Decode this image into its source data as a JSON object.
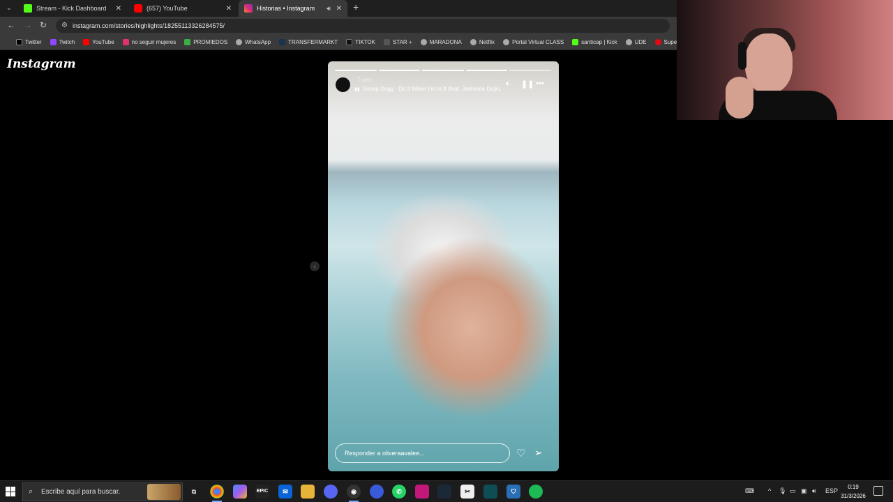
{
  "browser": {
    "tabs": [
      {
        "title": "Stream - Kick Dashboard",
        "favicon_color": "#53fc18"
      },
      {
        "title": "(657) YouTube",
        "favicon_color": "#ff0000"
      },
      {
        "title": "Historias • Instagram",
        "favicon_color": "#e1306c"
      }
    ],
    "url": "instagram.com/stories/highlights/18255113326284575/",
    "bookmarks": [
      {
        "label": "Twitter",
        "color": "#000000"
      },
      {
        "label": "Twitch",
        "color": "#9146ff"
      },
      {
        "label": "YouTube",
        "color": "#ff0000"
      },
      {
        "label": "no seguir mujeres",
        "color": "#e1306c"
      },
      {
        "label": "PROMIEDOS",
        "color": "#3cb043"
      },
      {
        "label": "WhatsApp",
        "color": "#aaaaaa"
      },
      {
        "label": "TRANSFERMARKT",
        "color": "#1a3151"
      },
      {
        "label": "TIKTOK",
        "color": "#111111"
      },
      {
        "label": "STAR +",
        "color": "#555555"
      },
      {
        "label": "MARADONA",
        "color": "#aaaaaa"
      },
      {
        "label": "Netflix",
        "color": "#aaaaaa"
      },
      {
        "label": "Portal Virtual CLASS",
        "color": "#aaaaaa"
      },
      {
        "label": "santicap | Kick",
        "color": "#53fc18"
      },
      {
        "label": "UDE",
        "color": "#aaaaaa"
      },
      {
        "label": "Supe",
        "color": "#e50914"
      }
    ]
  },
  "instagram": {
    "logo": "Instagram",
    "story": {
      "time_ago": "7 sem",
      "song": "Snoop Dogg · Do It When I'm In It (feat. Jermaine Dupri,",
      "progress_total": 5,
      "progress_done": 4,
      "reply_placeholder": "Responder a oliveraavalee..."
    }
  },
  "taskbar": {
    "search_placeholder": "Escribe aquí para buscar.",
    "language": "ESP",
    "time": "0:19",
    "date": "31/3/2026"
  }
}
